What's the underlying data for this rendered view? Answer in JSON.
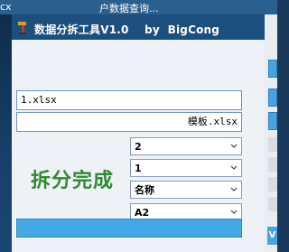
{
  "background_window": {
    "left_text": "cx",
    "title": "户数据查询..."
  },
  "app": {
    "title": "数据分拆工具V1.0    by  BigCong",
    "source_file": "1.xlsx",
    "template_file": "模板.xlsx",
    "status": "拆分完成",
    "selects": [
      {
        "value": "2"
      },
      {
        "value": "1"
      },
      {
        "value": "名称"
      },
      {
        "value": "A2"
      }
    ],
    "progress": 1.0
  },
  "side_panel": {
    "visible_letter": "V"
  },
  "colors": {
    "accent_blue": "#45a8e6",
    "status_green": "#2e8b2e",
    "window_dark": "#1c4f7e"
  },
  "icons": {
    "app": "scissors-tool-icon",
    "dropdown": "chevron-down-icon"
  }
}
